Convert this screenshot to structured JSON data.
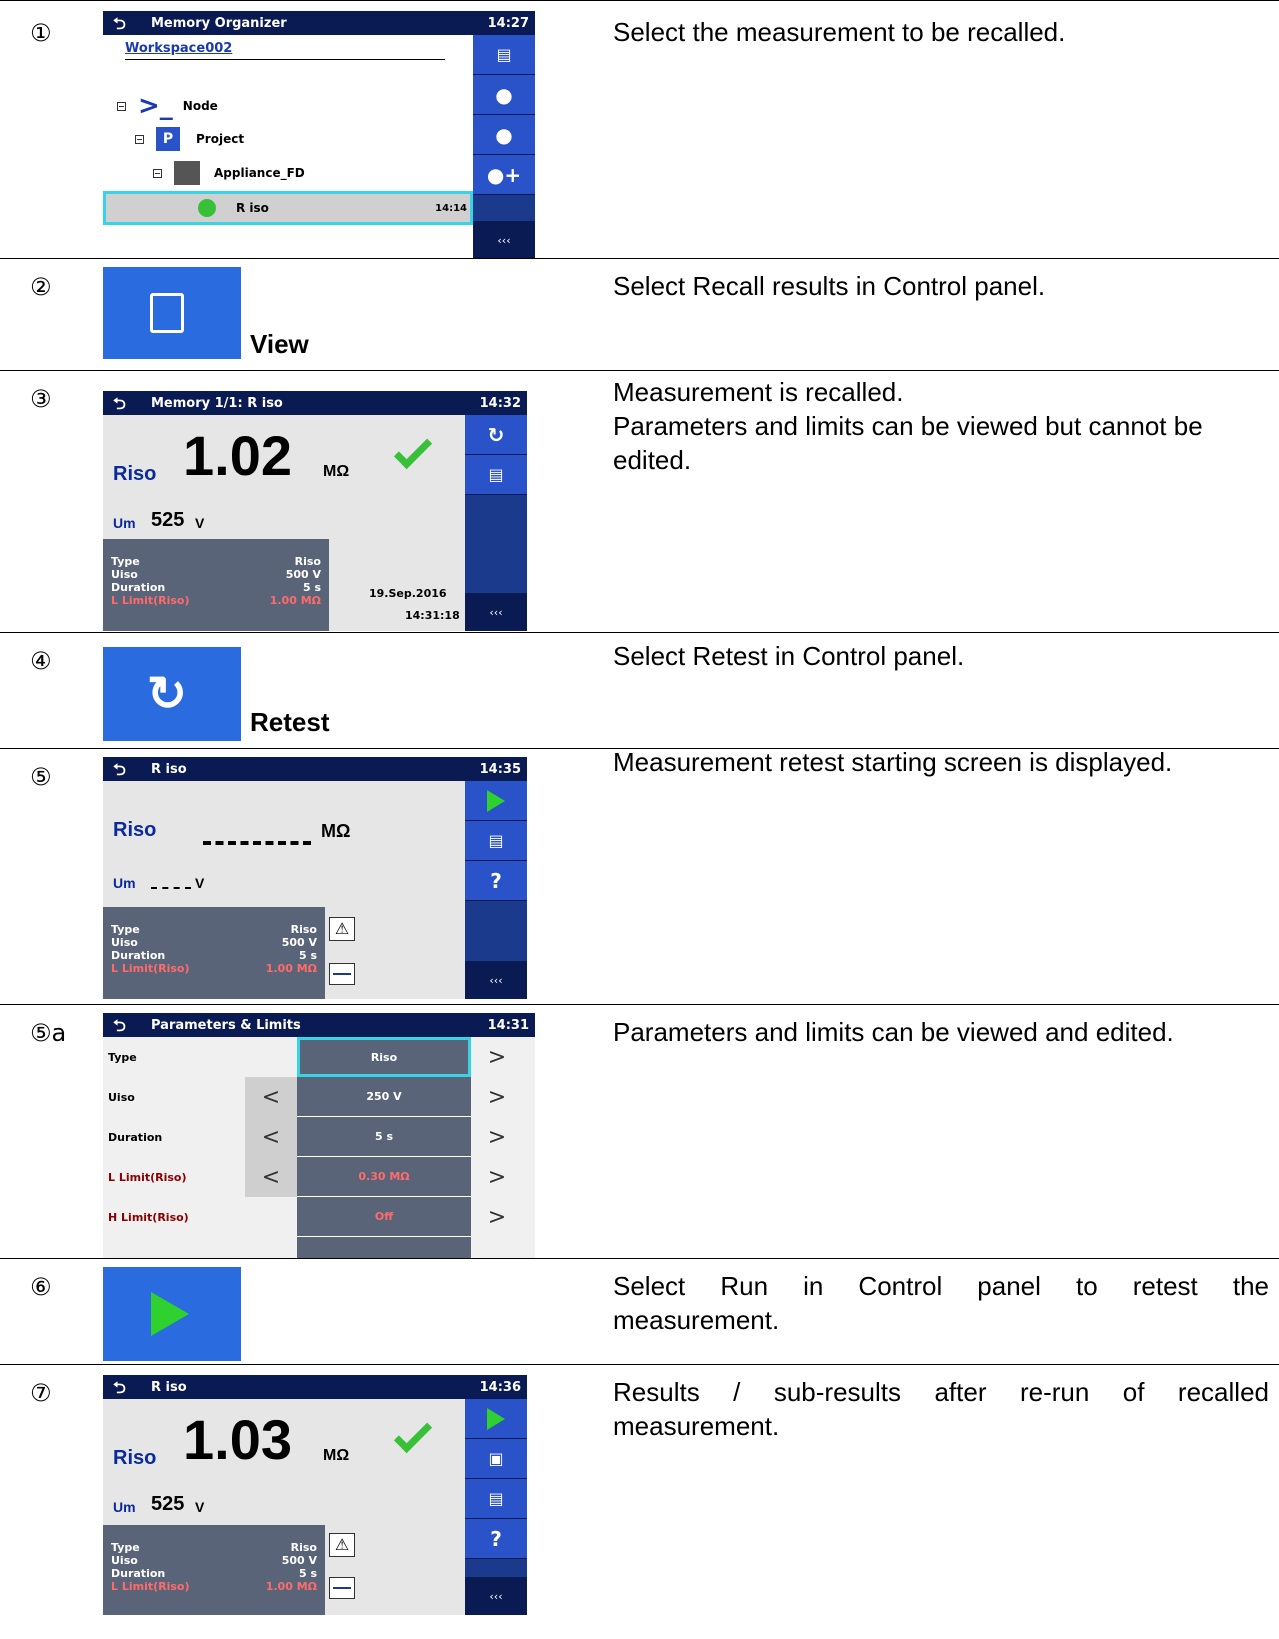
{
  "steps": [
    {
      "num": "①",
      "desc": "Select the measurement to be recalled."
    },
    {
      "num": "②",
      "desc": "Select Recall results in Control panel.",
      "tile_label": "View"
    },
    {
      "num": "③",
      "desc": "Measurement is recalled.\nParameters and limits can be viewed but cannot be edited."
    },
    {
      "num": "④",
      "desc": "Select Retest in Control panel.",
      "tile_label": "Retest"
    },
    {
      "num": "⑤",
      "desc": "Measurement retest starting screen is displayed."
    },
    {
      "num": "⑤a",
      "desc": "Parameters and limits can be viewed and edited."
    },
    {
      "num": "⑥",
      "desc_line1": "Select Run in Control panel to retest the",
      "desc_line2": "measurement."
    },
    {
      "num": "⑦",
      "desc_line1": "Results / sub-results after re-run of recalled",
      "desc_line2": "measurement."
    }
  ],
  "memory_organizer": {
    "title": "Memory Organizer",
    "time": "14:27",
    "workspace": "Workspace002",
    "tree": [
      "Node",
      "Project",
      "Appliance_FD"
    ],
    "selected_item": "R iso",
    "selected_time": "14:14",
    "dots": "‹‹‹"
  },
  "recalled": {
    "title": "Memory 1/1: R iso",
    "time": "14:32",
    "main_label": "Riso",
    "main_value": "1.02",
    "main_unit": "MΩ",
    "sub_label": "Um",
    "sub_value": "525",
    "sub_unit": "V",
    "date": "19.Sep.2016",
    "clock": "14:31:18"
  },
  "params": [
    {
      "name": "Type",
      "value": "Riso"
    },
    {
      "name": "Uiso",
      "value": "500 V"
    },
    {
      "name": "Duration",
      "value": "5 s"
    },
    {
      "name": "L Limit(Riso)",
      "value": "1.00 MΩ"
    }
  ],
  "retest": {
    "title": "R iso",
    "time": "14:35",
    "main_label": "Riso",
    "main_unit": "MΩ",
    "sub_label": "Um",
    "sub_unit": "V",
    "help": "?"
  },
  "param_limits": {
    "title": "Parameters & Limits",
    "time": "14:31",
    "rows": [
      {
        "name": "Type",
        "value": "Riso"
      },
      {
        "name": "Uiso",
        "value": "250 V"
      },
      {
        "name": "Duration",
        "value": "5 s"
      },
      {
        "name": "L Limit(Riso)",
        "value": "0.30 MΩ"
      },
      {
        "name": "H Limit(Riso)",
        "value": "Off"
      }
    ]
  },
  "result": {
    "title": "R iso",
    "time": "14:36",
    "main_label": "Riso",
    "main_value": "1.03",
    "main_unit": "MΩ",
    "sub_label": "Um",
    "sub_value": "525",
    "sub_unit": "V",
    "help": "?"
  },
  "colors": {
    "title_bar": "#0a1a52",
    "sidebar_button": "#2a52c9",
    "tile": "#2a6ce0",
    "pass_check": "#38c038",
    "param_box": "#5a6478"
  }
}
